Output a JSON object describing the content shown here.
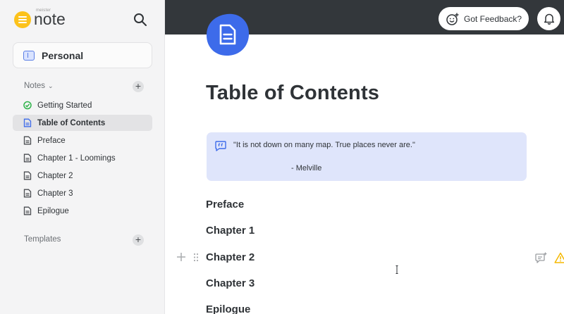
{
  "app": {
    "brand_small": "meister",
    "brand_name": "note"
  },
  "sidebar": {
    "workspace": "Personal",
    "notes_header": "Notes",
    "items": [
      {
        "label": "Getting Started",
        "icon": "check-circle-icon"
      },
      {
        "label": "Table of Contents",
        "icon": "document-icon",
        "active": true
      },
      {
        "label": "Preface",
        "icon": "document-icon"
      },
      {
        "label": "Chapter 1 - Loomings",
        "icon": "document-icon"
      },
      {
        "label": "Chapter 2",
        "icon": "document-icon"
      },
      {
        "label": "Chapter 3",
        "icon": "document-icon"
      },
      {
        "label": "Epilogue",
        "icon": "document-icon"
      }
    ],
    "templates_header": "Templates"
  },
  "topbar": {
    "feedback_label": "Got Feedback?"
  },
  "document": {
    "title": "Table of Contents",
    "quote": {
      "text": "\"It is not down on many map. True places never are.\"",
      "author": "- Melville"
    },
    "headings": [
      "Preface",
      "Chapter 1",
      "Chapter 2",
      "Chapter 3",
      "Epilogue"
    ]
  },
  "colors": {
    "accent_blue": "#3d6bea",
    "brand_yellow": "#fcc21b",
    "topbar": "#33373b",
    "quote_bg": "#dfe5fb",
    "success_green": "#2fb34a",
    "warning_yellow": "#f5b800"
  }
}
